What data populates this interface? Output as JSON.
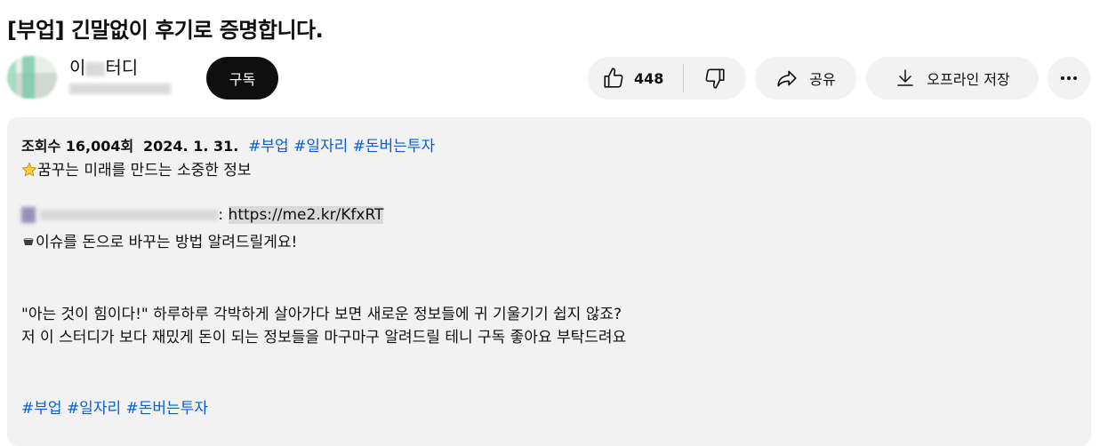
{
  "video": {
    "title": "[부업] 긴말없이 후기로 증명합니다."
  },
  "channel": {
    "name_visible_1": "이",
    "name_visible_2": "터디",
    "subscribe_label": "구독"
  },
  "actions": {
    "like_count": "448",
    "share_label": "공유",
    "offline_label": "오프라인 저장"
  },
  "icons": {
    "like": "thumbs-up-icon",
    "dislike": "thumbs-down-icon",
    "share": "share-arrow-icon",
    "offline": "download-icon",
    "more": "more-horizontal-icon",
    "star": "star-icon",
    "money": "money-bag-icon"
  },
  "description": {
    "views": "조회수 16,004회",
    "date": "2024. 1. 31.",
    "tags_top": [
      "#부업",
      "#일자리",
      "#돈버는투자"
    ],
    "line_star": "꿈꾸는 미래를 만드는 소중한 정보",
    "link_sep": ":",
    "link": "https://me2.kr/KfxRT",
    "line_money": "이슈를 돈으로 바꾸는 방법 알려드릴게요!",
    "para_1": "\"아는 것이 힘이다!\" 하루하루 각박하게 살아가다 보면 새로운 정보들에 귀 기울기기 쉽지 않죠?",
    "para_2": "저 이 스터디가 보다 재밌게 돈이 되는 정보들을 마구마구 알려드릴 테니 구독 좋아요 부탁드려요",
    "tags_bottom": [
      "#부업",
      "#일자리",
      "#돈버는투자"
    ]
  },
  "colors": {
    "hashtag": "#065fd4",
    "pill_bg": "#f2f2f2",
    "subscribe_bg": "#0f0f0f"
  }
}
